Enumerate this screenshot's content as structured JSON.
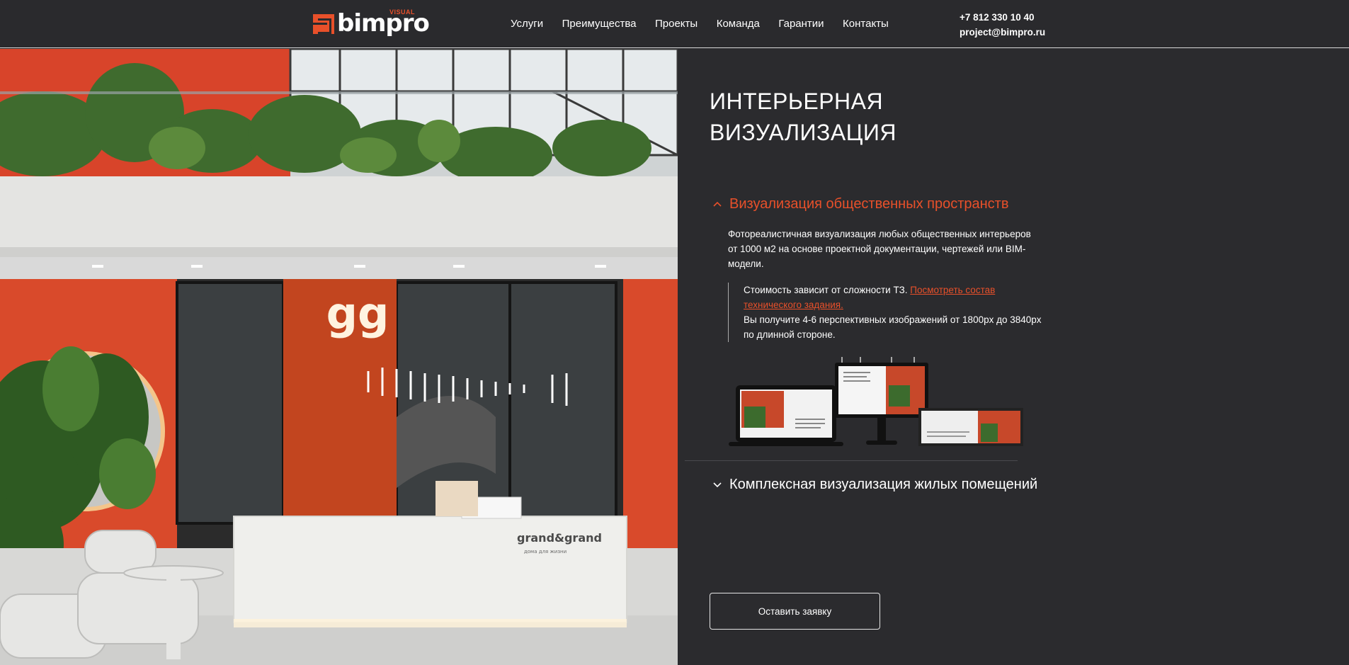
{
  "header": {
    "logo_text": "bimpro",
    "logo_sub": "VISUAL",
    "nav": [
      "Услуги",
      "Преимущества",
      "Проекты",
      "Команда",
      "Гарантии",
      "Контакты"
    ],
    "phone": "+7 812 330 10 40",
    "email": "project@bimpro.ru"
  },
  "hero": {
    "image_alt": "Интерьер общественного пространства",
    "sign_logo": "gg",
    "desk_brand": "grand&grand",
    "desk_sub": "дома для жизни"
  },
  "panel": {
    "title_line1": "ИНТЕРЬЕРНАЯ",
    "title_line2": "ВИЗУАЛИЗАЦИЯ",
    "accordion": [
      {
        "title": "Визуализация общественных пространств",
        "expanded": true,
        "description": "Фотореалистичная визуализация любых общественных интерьеров от 1000 м2 на основе проектной документации, чертежей или BIM-модели.",
        "note_prefix": "Стоимость зависит от сложности ТЗ. ",
        "note_link": "Посмотреть состав технического задания.",
        "note_suffix": "Вы получите 4-6 перспективных изображений от 1800px до 3840px по длинной стороне."
      },
      {
        "title": "Комплексная визуализация жилых помещений",
        "expanded": false
      }
    ],
    "cta_label": "Оставить заявку"
  },
  "colors": {
    "accent": "#e8502a",
    "background": "#2b2b2e",
    "text": "#ffffff"
  }
}
